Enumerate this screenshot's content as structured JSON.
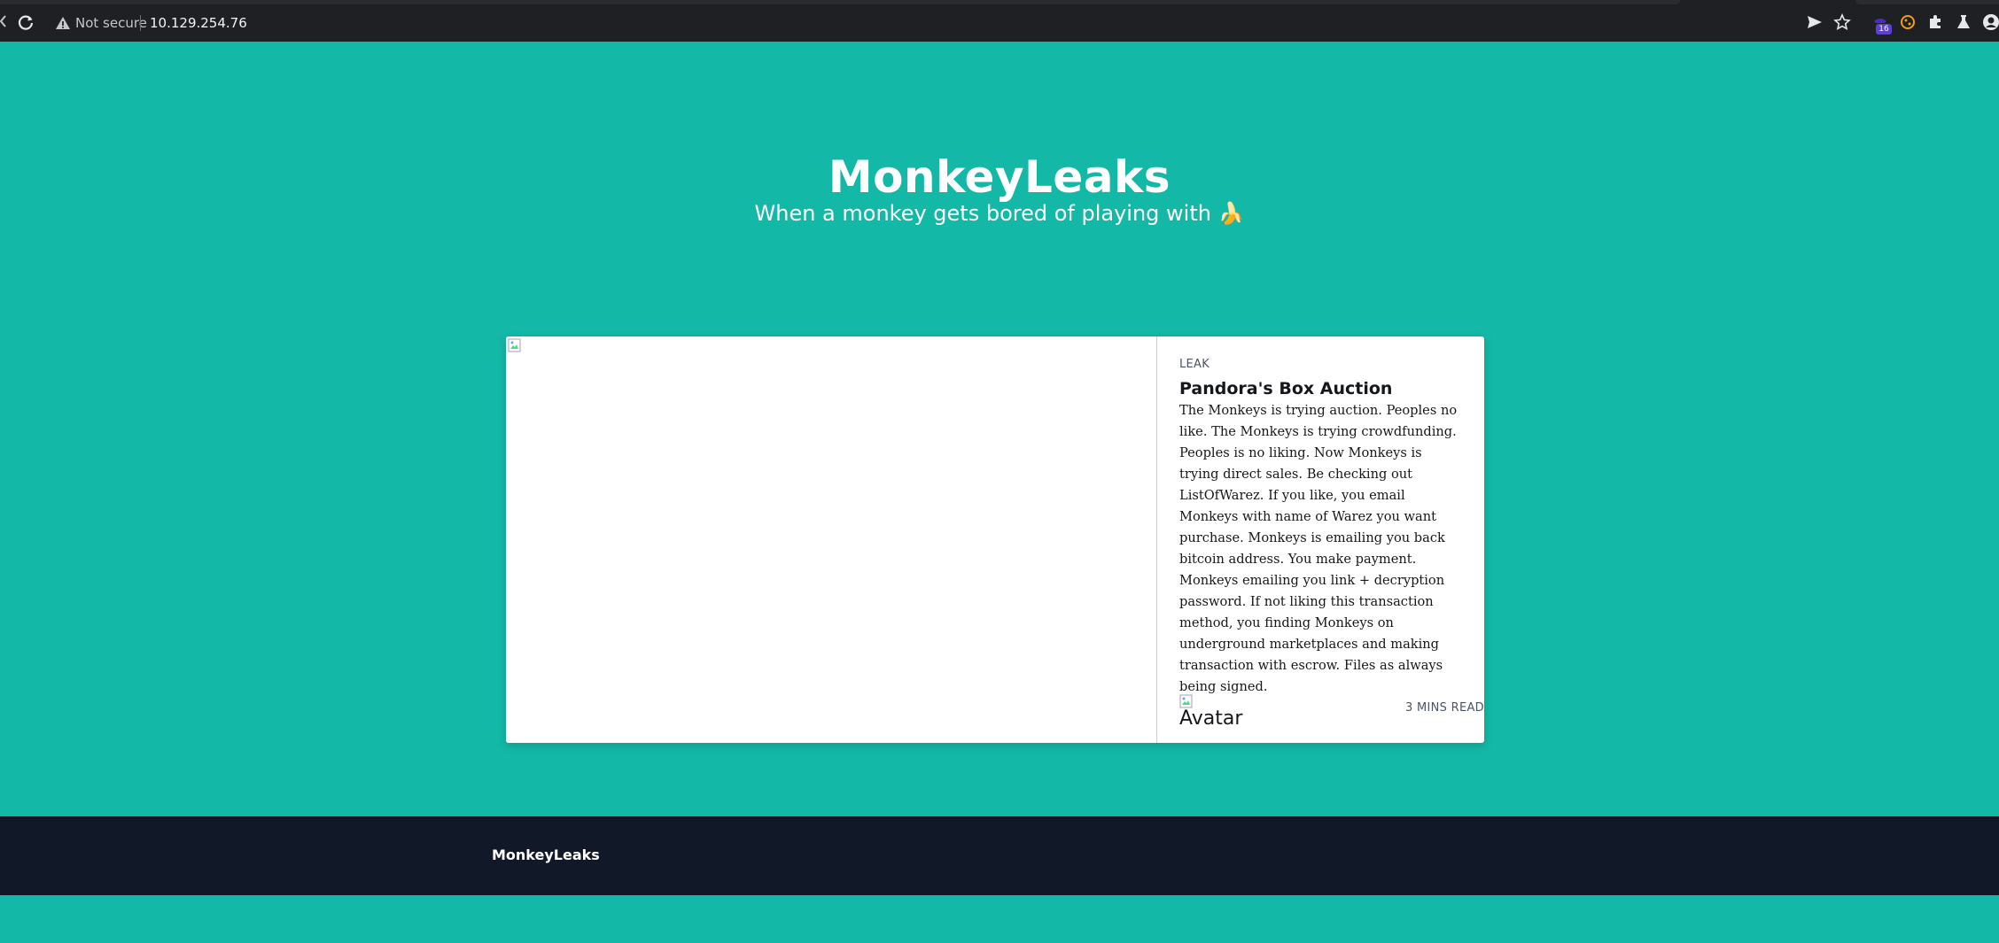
{
  "browser": {
    "security_label": "Not secure",
    "url": "10.129.254.76",
    "extension_badge": "16",
    "icons": [
      "back-arrow-icon",
      "reload-icon",
      "warning-icon",
      "send-icon",
      "star-icon",
      "extension-icon",
      "cookie-icon",
      "puzzle-icon",
      "flask-icon",
      "profile-icon"
    ]
  },
  "hero": {
    "title": "MonkeyLeaks",
    "subtitle": "When a monkey gets bored of playing with 🍌"
  },
  "post": {
    "tag": "LEAK",
    "title": "Pandora's Box Auction",
    "excerpt": "The Monkeys is trying auction. Peoples no like. The Monkeys is trying crowdfunding. Peoples is no liking. Now Monkeys is trying direct sales. Be checking out ListOfWarez. If you like, you email Monkeys with name of Warez you want purchase. Monkeys is emailing you back bitcoin address. You make payment. Monkeys emailing you link + decryption password. If not liking this transaction method, you finding Monkeys on underground marketplaces and making transaction with escrow. Files as always being signed.",
    "avatar_alt": "Avatar",
    "read_time": "3 mins read"
  },
  "footer": {
    "title": "MonkeyLeaks"
  },
  "colors": {
    "page_background": "#14b8a6",
    "footer_background": "#111827",
    "browser_chrome": "#1f2023",
    "card_background": "#ffffff"
  }
}
